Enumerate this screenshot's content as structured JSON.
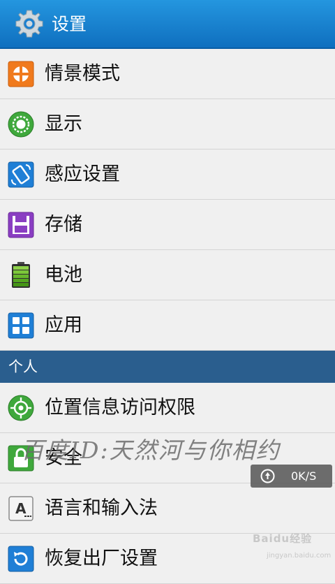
{
  "header": {
    "title": "设置",
    "icon": "settings-gear-icon"
  },
  "items_top": [
    {
      "label": "情景模式",
      "icon": "scene-mode-icon"
    },
    {
      "label": "显示",
      "icon": "display-icon"
    },
    {
      "label": "感应设置",
      "icon": "motion-sensor-icon"
    },
    {
      "label": "存储",
      "icon": "storage-icon"
    },
    {
      "label": "电池",
      "icon": "battery-icon"
    },
    {
      "label": "应用",
      "icon": "apps-grid-icon"
    }
  ],
  "section_personal": {
    "label": "个人"
  },
  "items_personal": [
    {
      "label": "位置信息访问权限",
      "icon": "location-icon"
    },
    {
      "label": "安全",
      "icon": "lock-icon"
    },
    {
      "label": "语言和输入法",
      "icon": "keyboard-language-icon"
    },
    {
      "label": "恢复出厂设置",
      "icon": "factory-reset-icon"
    }
  ],
  "overlay": {
    "watermark": "百度ID:天然河与你相约",
    "speed_value": "0K/S",
    "baidu_logo": "Baidu经验",
    "baidu_sub": "jingyan.baidu.com"
  },
  "colors": {
    "header": "#1a7fd0",
    "section": "#2a5e8e",
    "background": "#f0f0f0"
  }
}
